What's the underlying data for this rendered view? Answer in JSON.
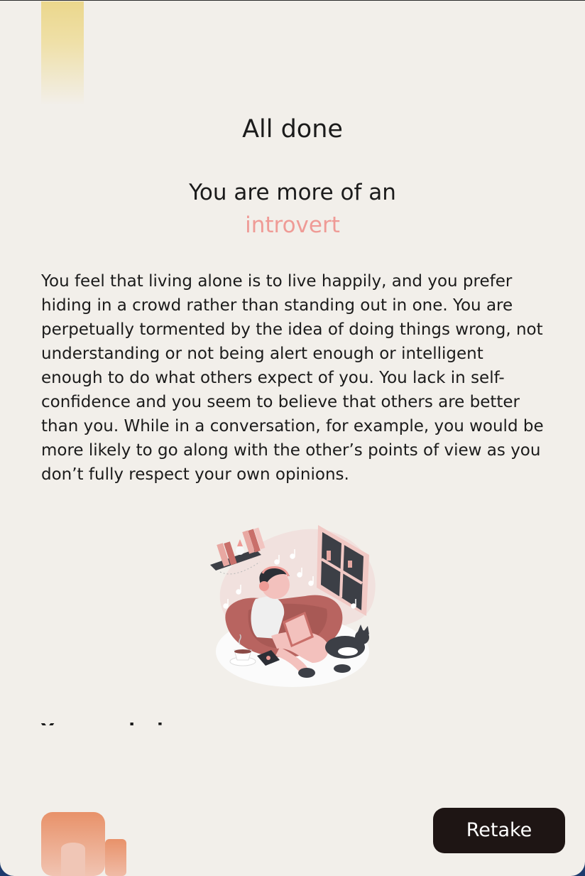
{
  "result_screen": {
    "title": "All done",
    "subtitle": "You are more of an",
    "result": "introvert",
    "description": "You feel that living alone is to live happily, and you prefer hiding in a crowd rather than standing out in one. You are perpetually tormented by the idea of doing things wrong, not understanding or not being alert enough or intelligent enough to do what others expect of you. You lack in self-confidence and you seem to believe that others are better than you. While in a conversation, for example, you would be more likely to go along with the other’s points of view as you don’t fully respect your own opinions.",
    "next_section_heading_partial": "Your analysis",
    "illustration_icon": "person-reading-with-headphones-illustration",
    "retake_label": "Retake"
  },
  "colors": {
    "background": "#f2efea",
    "accent": "#ef9b96",
    "button": "#1e1514",
    "logo": "#e8926a",
    "top_decoration": "#ebd78c"
  }
}
